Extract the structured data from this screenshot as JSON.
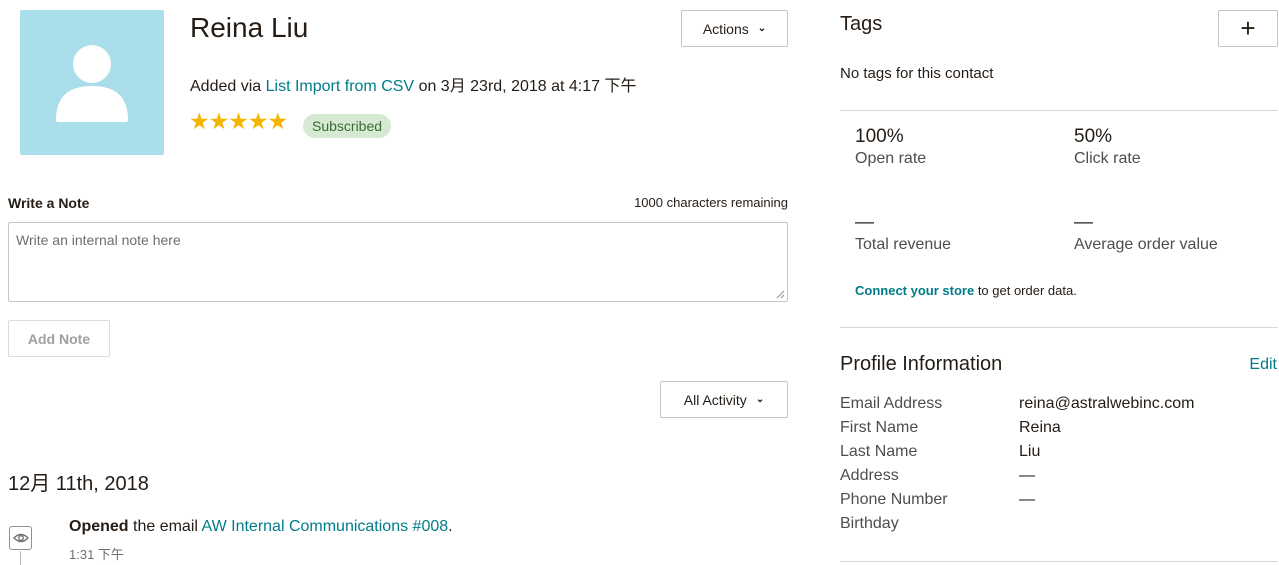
{
  "contact": {
    "name": "Reina Liu",
    "added_prefix": "Added via",
    "added_source": "List Import from CSV",
    "added_suffix": "on 3月 23rd, 2018 at 4:17 下午",
    "stars": "★★★★★",
    "rating": 5,
    "status_badge": "Subscribed"
  },
  "actions_label": "Actions",
  "note": {
    "label": "Write a Note",
    "remaining": "1000 characters remaining",
    "placeholder": "Write an internal note here",
    "add_button": "Add Note"
  },
  "activity": {
    "filter_label": "All Activity",
    "date": "12月 11th, 2018",
    "items": [
      {
        "verb": "Opened",
        "text": "the email",
        "link": "AW Internal Communications #008",
        "trail": ".",
        "time": "1:31 下午",
        "icon": "eye-icon"
      }
    ]
  },
  "tags": {
    "title": "Tags",
    "add_label": "+",
    "empty": "No tags for this contact"
  },
  "stats": {
    "open_rate": "100%",
    "open_rate_label": "Open rate",
    "click_rate": "50%",
    "click_rate_label": "Click rate",
    "total_revenue": "—",
    "total_revenue_label": "Total revenue",
    "avg_order": "—",
    "avg_order_label": "Average order value",
    "connect_link": "Connect your store",
    "connect_text": "to get order data."
  },
  "profile": {
    "title": "Profile Information",
    "edit": "Edit",
    "fields": [
      {
        "label": "Email Address",
        "value": "reina@astralwebinc.com"
      },
      {
        "label": "First Name",
        "value": "Reina"
      },
      {
        "label": "Last Name",
        "value": "Liu"
      },
      {
        "label": "Address",
        "value": "—"
      },
      {
        "label": "Phone Number",
        "value": "—"
      },
      {
        "label": "Birthday",
        "value": ""
      }
    ]
  },
  "colors": {
    "link": "#007c89",
    "avatar_bg": "#aadeea",
    "star": "#f4b400",
    "badge_bg": "#d6ead3"
  }
}
